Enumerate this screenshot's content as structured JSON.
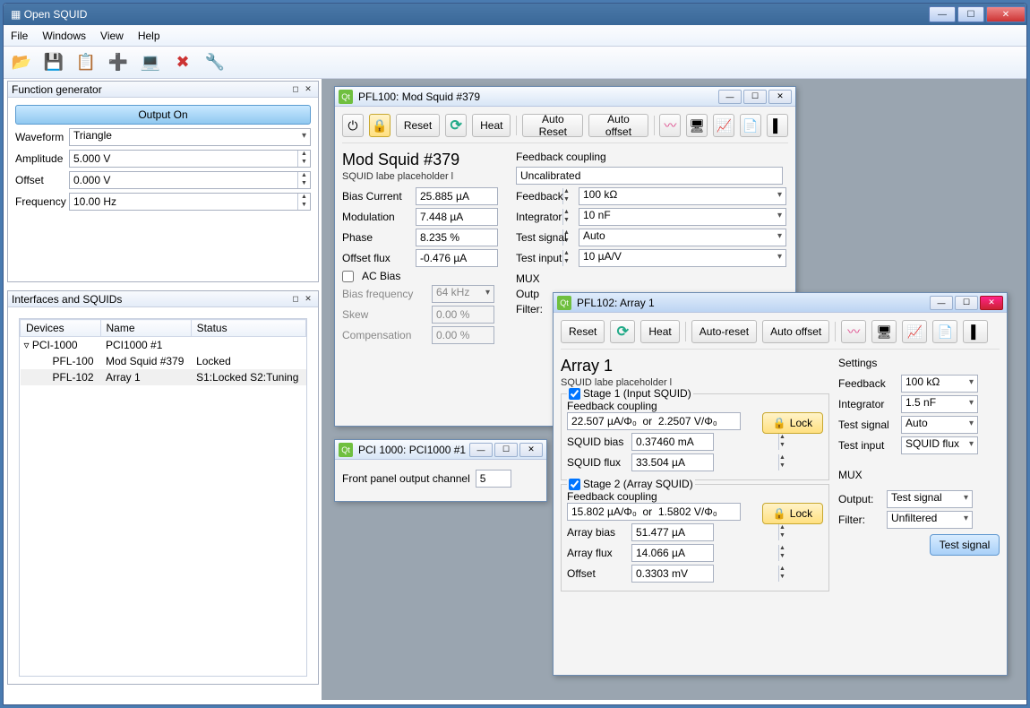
{
  "window": {
    "title": "Open SQUID"
  },
  "menu": {
    "file": "File",
    "windows": "Windows",
    "view": "View",
    "help": "Help"
  },
  "toolbar_icons": {
    "open": "📂",
    "save": "💾",
    "saveas": "📋",
    "add": "➕",
    "board": "💻",
    "delete": "✖",
    "wrench": "🔧"
  },
  "funcgen": {
    "title": "Function generator",
    "output_btn": "Output On",
    "waveform_label": "Waveform",
    "waveform_value": "Triangle",
    "amplitude_label": "Amplitude",
    "amplitude_value": "5.000 V",
    "offset_label": "Offset",
    "offset_value": "0.000 V",
    "frequency_label": "Frequency",
    "frequency_value": "10.00 Hz"
  },
  "devtree": {
    "title": "Interfaces and SQUIDs",
    "cols": {
      "devices": "Devices",
      "name": "Name",
      "status": "Status"
    },
    "rows": [
      {
        "d": "PCI-1000",
        "n": "PCI1000 #1",
        "s": ""
      },
      {
        "d": "PFL-100",
        "n": "Mod Squid #379",
        "s": "Locked"
      },
      {
        "d": "PFL-102",
        "n": "Array 1",
        "s": "S1:Locked  S2:Tuning"
      }
    ]
  },
  "pfl100": {
    "title": "PFL100: Mod Squid #379",
    "reset": "Reset",
    "heat": "Heat",
    "auto_reset": "Auto Reset",
    "auto_offset": "Auto offset",
    "name": "Mod Squid #379",
    "placeholder": "SQUID labe placeholder l",
    "bias_current_l": "Bias Current",
    "bias_current_v": "25.885 µA",
    "modulation_l": "Modulation",
    "modulation_v": "7.448 µA",
    "phase_l": "Phase",
    "phase_v": "8.235 %",
    "offset_flux_l": "Offset flux",
    "offset_flux_v": "-0.476 µA",
    "ac_bias": "AC Bias",
    "bias_freq_l": "Bias frequency",
    "bias_freq_v": "64 kHz",
    "skew_l": "Skew",
    "skew_v": "0.00 %",
    "comp_l": "Compensation",
    "comp_v": "0.00 %",
    "fb_coupling_l": "Feedback coupling",
    "fb_coupling_v": "Uncalibrated",
    "feedback_l": "Feedback",
    "feedback_v": "100 kΩ",
    "integrator_l": "Integrator",
    "integrator_v": "10 nF",
    "test_signal_l": "Test signal",
    "test_signal_v": "Auto",
    "test_input_l": "Test input",
    "test_input_v": "10 µA/V",
    "mux_l": "MUX",
    "output_l": "Outp",
    "filter_l": "Filter:"
  },
  "pci1000": {
    "title": "PCI 1000: PCI1000 #1",
    "fp_label": "Front panel output channel",
    "fp_value": "5"
  },
  "pfl102": {
    "title": "PFL102: Array 1",
    "reset": "Reset",
    "heat": "Heat",
    "auto_reset": "Auto-reset",
    "auto_offset": "Auto offset",
    "name": "Array 1",
    "placeholder": "SQUID labe placeholder l",
    "stage1_l": "Stage 1 (Input SQUID)",
    "s1_fb_l": "Feedback coupling",
    "s1_fb_v": "22.507 µA/Φ₀  or  2.2507 V/Φ₀",
    "s1_bias_l": "SQUID bias",
    "s1_bias_v": "0.37460 mA",
    "s1_flux_l": "SQUID flux",
    "s1_flux_v": "33.504 µA",
    "lock": "Lock",
    "stage2_l": "Stage 2 (Array SQUID)",
    "s2_fb_l": "Feedback coupling",
    "s2_fb_v": "15.802 µA/Φ₀  or  1.5802 V/Φ₀",
    "s2_abias_l": "Array bias",
    "s2_abias_v": "51.477 µA",
    "s2_aflux_l": "Array flux",
    "s2_aflux_v": "14.066 µA",
    "s2_off_l": "Offset",
    "s2_off_v": "0.3303 mV",
    "settings_l": "Settings",
    "set_fb_l": "Feedback",
    "set_fb_v": "100 kΩ",
    "set_int_l": "Integrator",
    "set_int_v": "1.5 nF",
    "set_ts_l": "Test signal",
    "set_ts_v": "Auto",
    "set_ti_l": "Test input",
    "set_ti_v": "SQUID flux",
    "mux_l": "MUX",
    "mux_out_l": "Output:",
    "mux_out_v": "Test signal",
    "mux_filt_l": "Filter:",
    "mux_filt_v": "Unfiltered",
    "test_btn": "Test signal"
  }
}
